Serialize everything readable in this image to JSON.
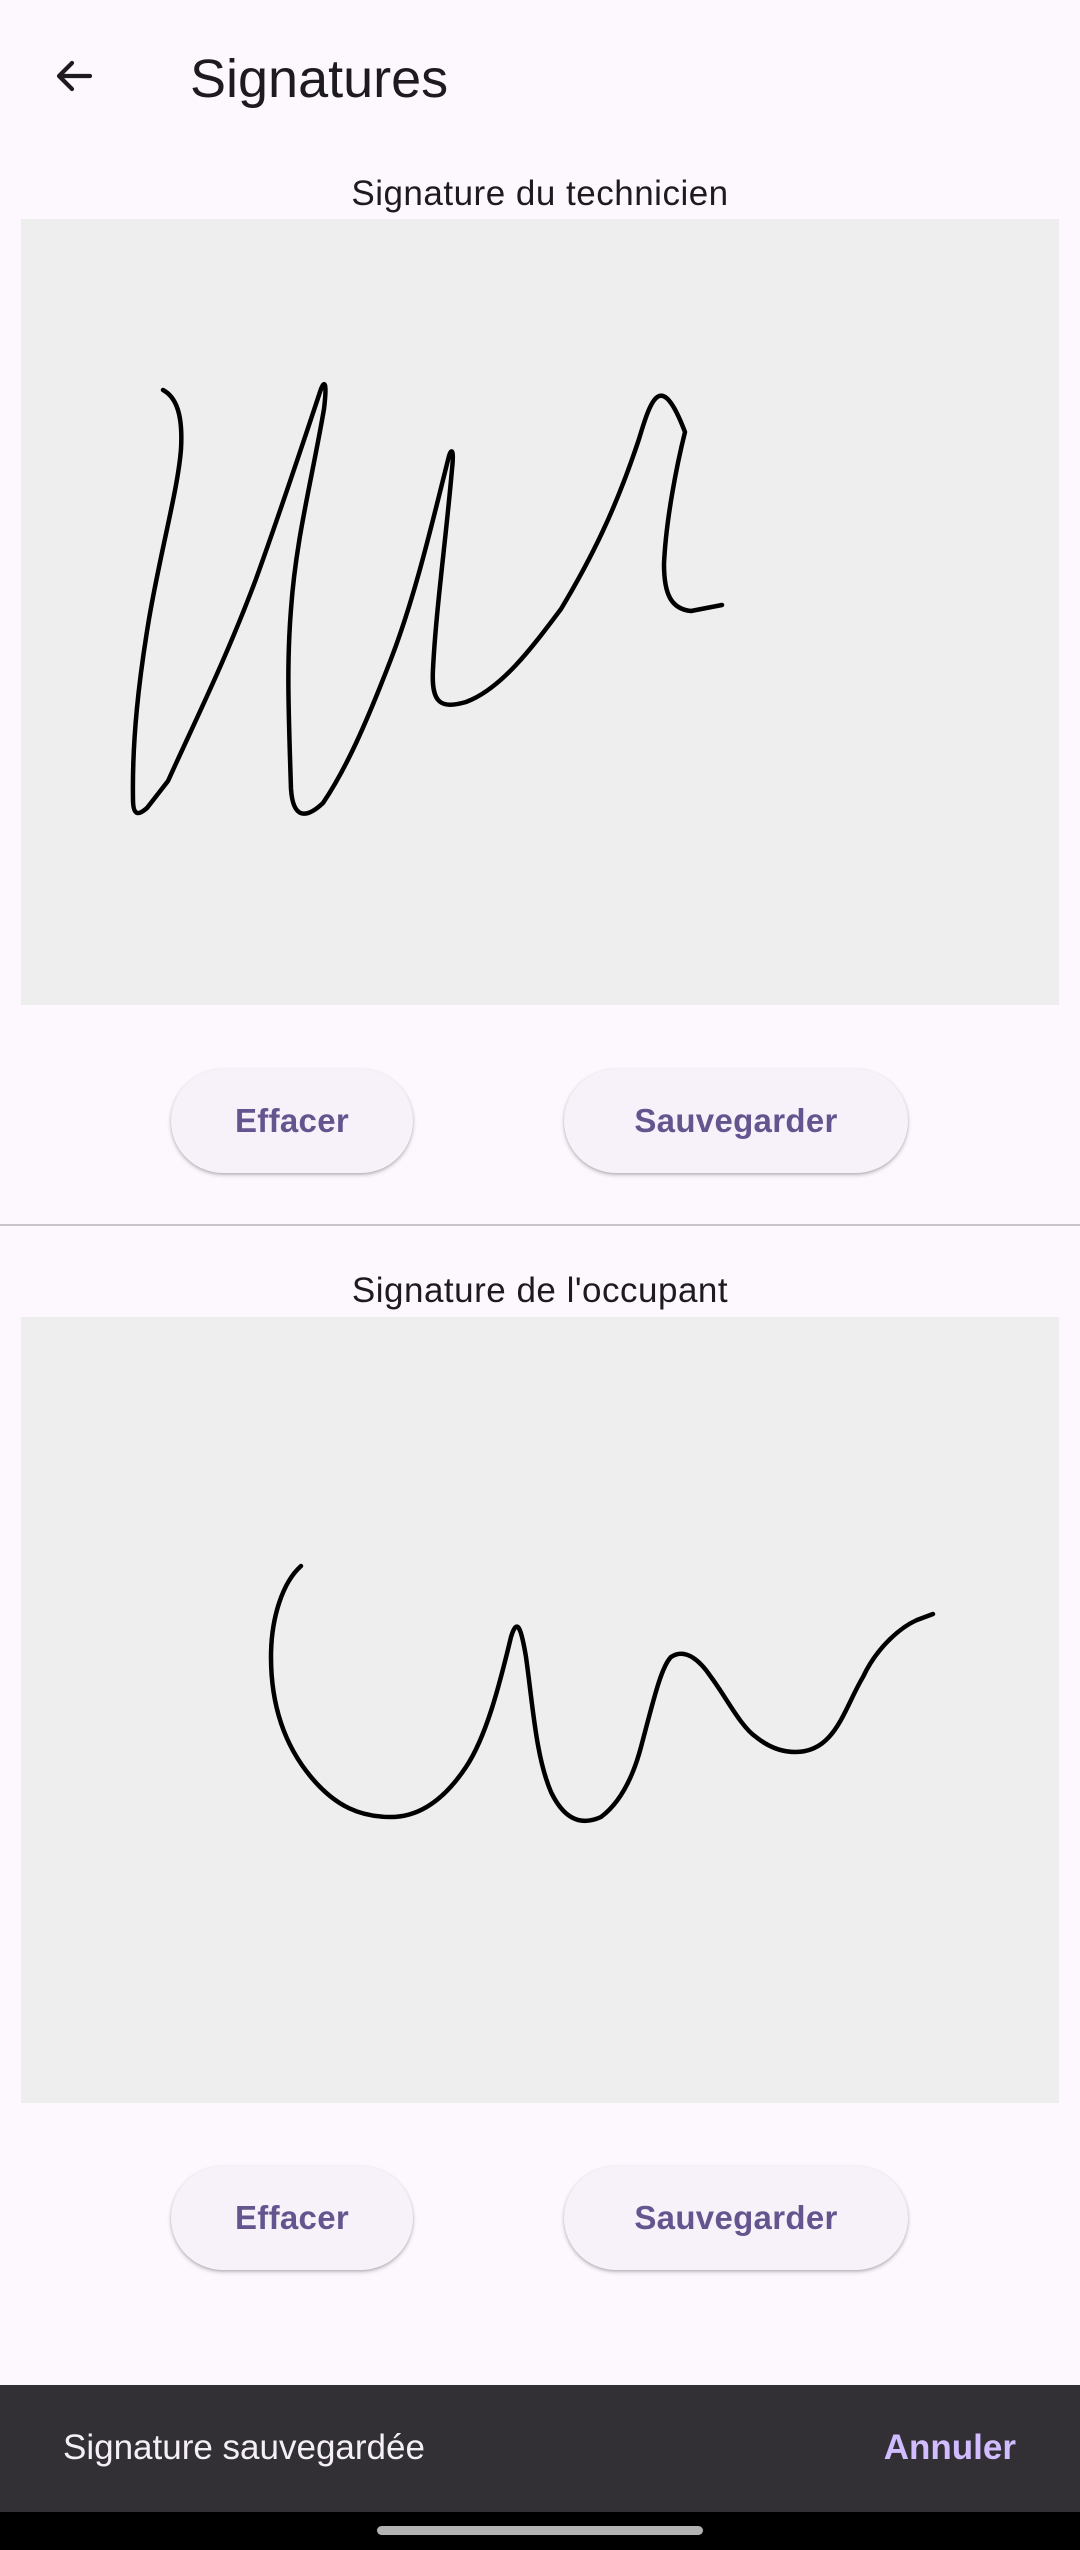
{
  "app_bar": {
    "back_icon": "arrow-back-icon",
    "title": "Signatures"
  },
  "sections": [
    {
      "label": "Signature du technicien",
      "clear_label": "Effacer",
      "save_label": "Sauvegarder"
    },
    {
      "label": "Signature de l'occupant",
      "clear_label": "Effacer",
      "save_label": "Sauvegarder"
    }
  ],
  "snackbar": {
    "message": "Signature sauvegardée",
    "action_label": "Annuler"
  },
  "colors": {
    "background": "#fdf7fe",
    "pad": "#eeeeee",
    "button_text": "#65558f",
    "snackbar": "#322f35",
    "snackbar_action": "#d0bcff",
    "ink": "#000000"
  }
}
